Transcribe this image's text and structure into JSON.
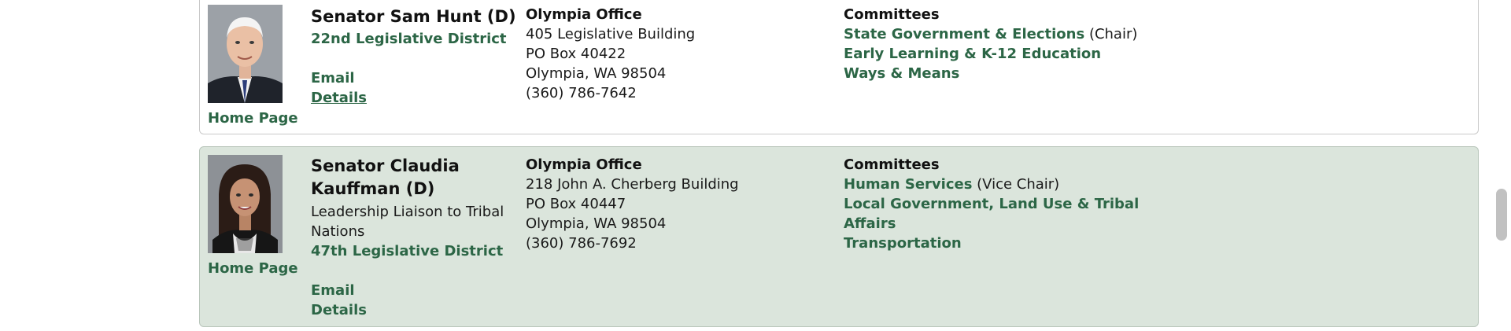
{
  "members": [
    {
      "name": "Senator Sam Hunt (D)",
      "title": "",
      "district": "22nd Legislative District",
      "email_label": "Email",
      "details_label": "Details",
      "homepage_label": "Home Page",
      "office": {
        "heading": "Olympia Office",
        "line1": "405 Legislative Building",
        "line2": "PO Box 40422",
        "line3": "Olympia, WA 98504",
        "phone": "(360) 786-7642"
      },
      "committees": {
        "heading": "Committees",
        "items": [
          {
            "name": "State Government & Elections",
            "role": "(Chair)"
          },
          {
            "name": "Early Learning & K-12 Education",
            "role": ""
          },
          {
            "name": "Ways & Means",
            "role": ""
          }
        ]
      }
    },
    {
      "name": "Senator Claudia Kauffman (D)",
      "name_line1": "Senator Claudia",
      "name_line2": "Kauffman (D)",
      "title_line1": "Leadership Liaison to Tribal",
      "title_line2": "Nations",
      "district": "47th Legislative District",
      "email_label": "Email",
      "details_label": "Details",
      "homepage_label": "Home Page",
      "office": {
        "heading": "Olympia Office",
        "line1": "218 John A. Cherberg Building",
        "line2": "PO Box 40447",
        "line3": "Olympia, WA 98504",
        "phone": "(360) 786-7692"
      },
      "committees": {
        "heading": "Committees",
        "items": [
          {
            "name": "Human Services",
            "role": "(Vice Chair)"
          },
          {
            "name_line1": "Local Government, Land Use & Tribal",
            "name_line2": "Affairs",
            "role": ""
          },
          {
            "name": "Transportation",
            "role": ""
          }
        ]
      }
    }
  ],
  "colors": {
    "link": "#2c6646",
    "alt_row_bg": "#dbe5dc",
    "border": "#c9c9c9"
  }
}
